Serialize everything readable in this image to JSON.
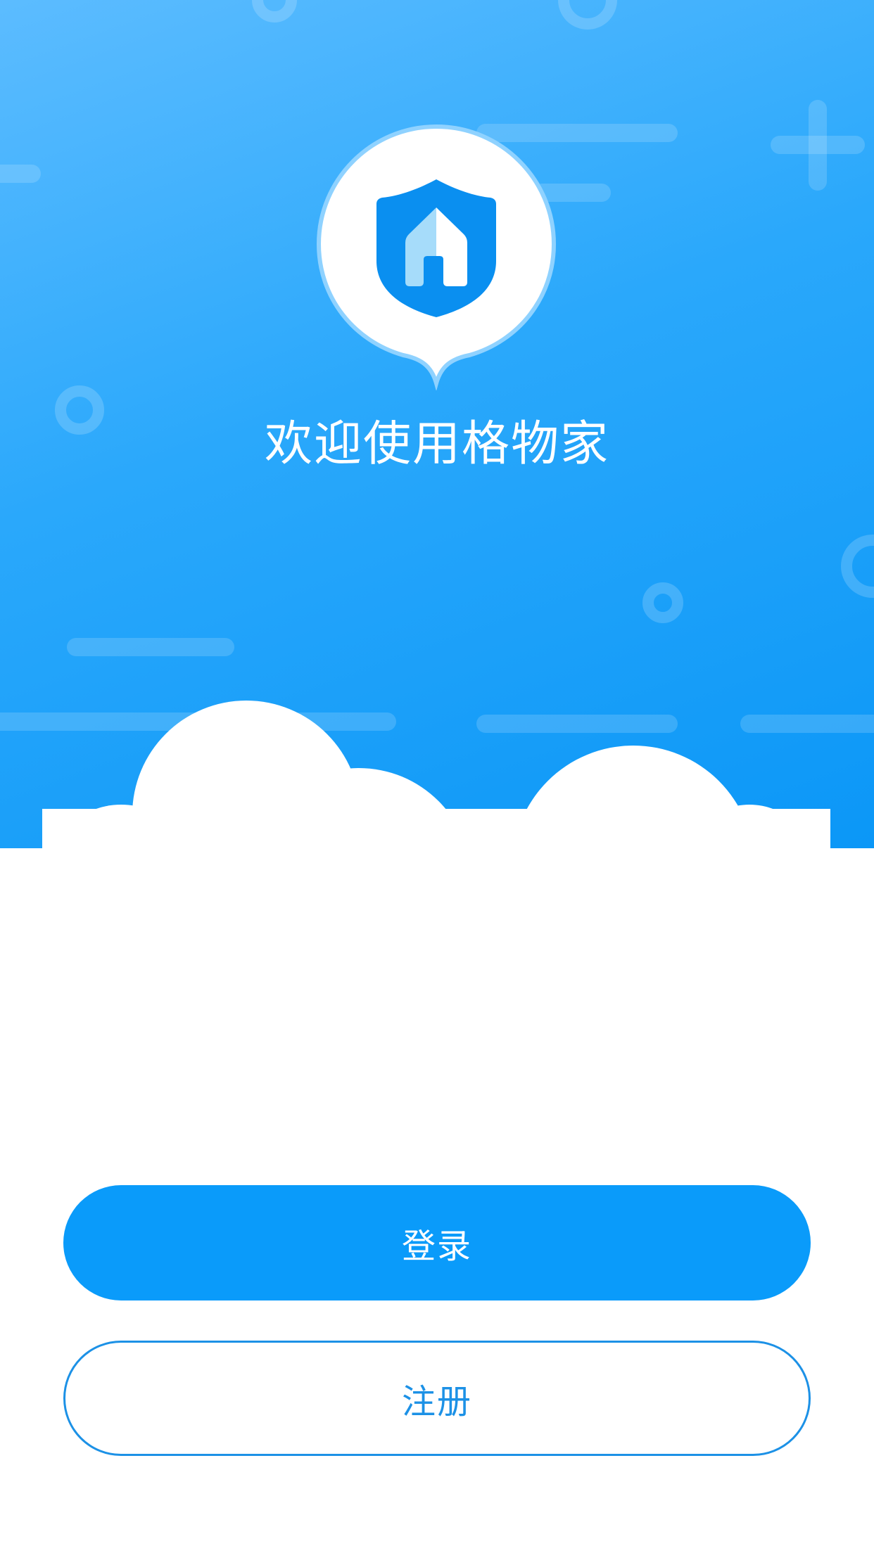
{
  "app": {
    "welcome_text": "欢迎使用格物家"
  },
  "logo": {
    "icon": "shield-house-icon",
    "badge_color": "#ffffff",
    "shield_color": "#0a8ff0"
  },
  "actions": {
    "login_label": "登录",
    "register_label": "注册"
  },
  "colors": {
    "primary": "#0a9bfa",
    "outline": "#1c91e6",
    "hero_gradient_start": "#5cbcff",
    "hero_gradient_end": "#0b97f7"
  }
}
